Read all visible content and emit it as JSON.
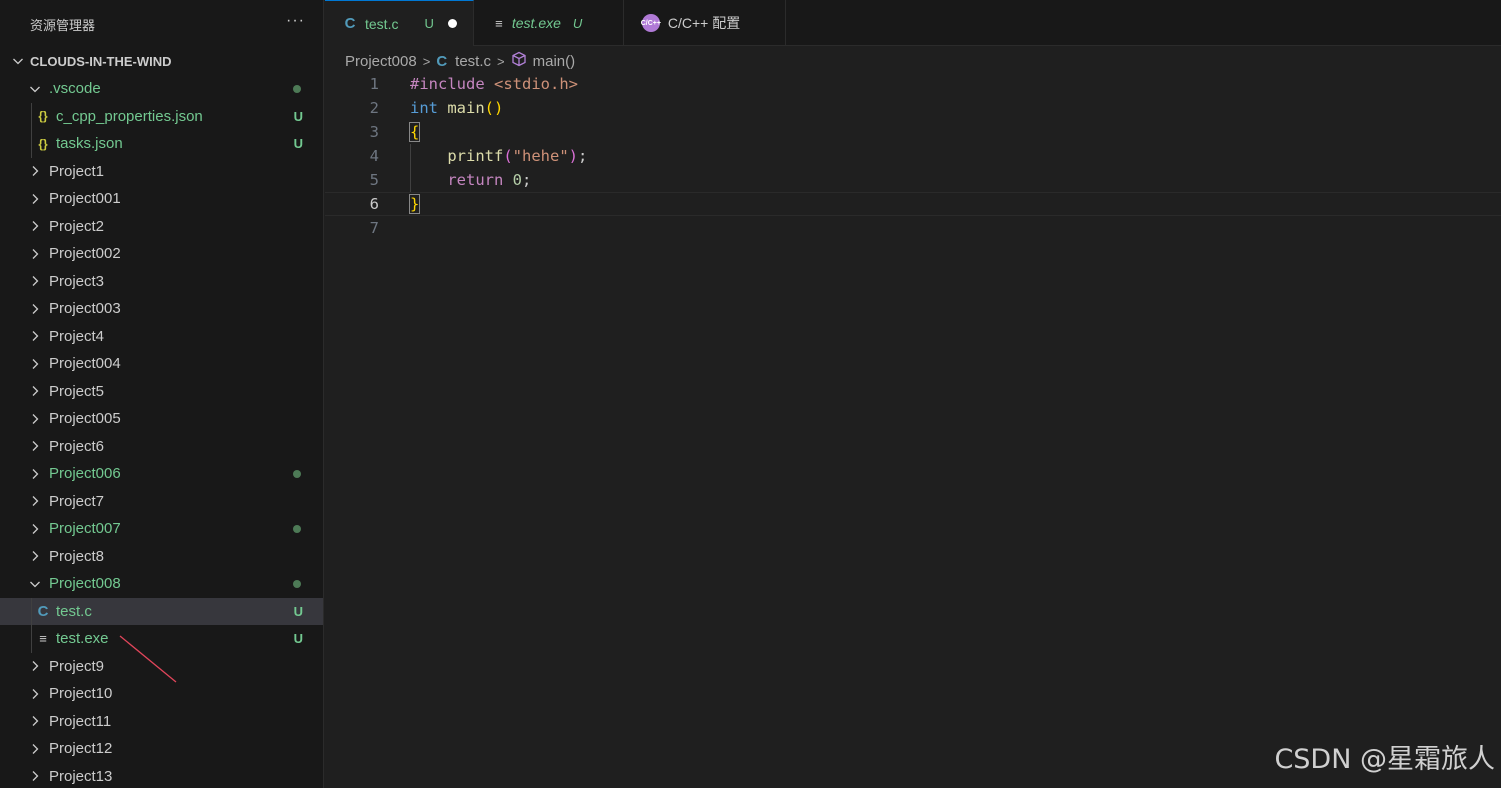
{
  "sidebar": {
    "title": "资源管理器",
    "more": "···",
    "root": "CLOUDS-IN-THE-WIND",
    "items": [
      {
        "label": ".vscode",
        "depth": 1,
        "expanded": true,
        "green": true,
        "dot": true
      },
      {
        "label": "c_cpp_properties.json",
        "depth": 2,
        "icon": "json",
        "green": true,
        "status": "U"
      },
      {
        "label": "tasks.json",
        "depth": 2,
        "icon": "json",
        "green": true,
        "status": "U"
      },
      {
        "label": "Project1",
        "depth": 1,
        "expanded": false
      },
      {
        "label": "Project001",
        "depth": 1,
        "expanded": false
      },
      {
        "label": "Project2",
        "depth": 1,
        "expanded": false
      },
      {
        "label": "Project002",
        "depth": 1,
        "expanded": false
      },
      {
        "label": "Project3",
        "depth": 1,
        "expanded": false
      },
      {
        "label": "Project003",
        "depth": 1,
        "expanded": false
      },
      {
        "label": "Project4",
        "depth": 1,
        "expanded": false
      },
      {
        "label": "Project004",
        "depth": 1,
        "expanded": false
      },
      {
        "label": "Project5",
        "depth": 1,
        "expanded": false
      },
      {
        "label": "Project005",
        "depth": 1,
        "expanded": false
      },
      {
        "label": "Project6",
        "depth": 1,
        "expanded": false
      },
      {
        "label": "Project006",
        "depth": 1,
        "expanded": false,
        "green": true,
        "dot": true
      },
      {
        "label": "Project7",
        "depth": 1,
        "expanded": false
      },
      {
        "label": "Project007",
        "depth": 1,
        "expanded": false,
        "green": true,
        "dot": true
      },
      {
        "label": "Project8",
        "depth": 1,
        "expanded": false
      },
      {
        "label": "Project008",
        "depth": 1,
        "expanded": true,
        "green": true,
        "dot": true
      },
      {
        "label": "test.c",
        "depth": 2,
        "icon": "c",
        "green": true,
        "status": "U",
        "selected": true
      },
      {
        "label": "test.exe",
        "depth": 2,
        "icon": "file",
        "green": true,
        "status": "U"
      },
      {
        "label": "Project9",
        "depth": 1,
        "expanded": false
      },
      {
        "label": "Project10",
        "depth": 1,
        "expanded": false
      },
      {
        "label": "Project11",
        "depth": 1,
        "expanded": false
      },
      {
        "label": "Project12",
        "depth": 1,
        "expanded": false
      },
      {
        "label": "Project13",
        "depth": 1,
        "expanded": false
      }
    ]
  },
  "tabs": [
    {
      "label": "test.c",
      "status": "U",
      "icon": "C",
      "active": true,
      "modified": true
    },
    {
      "label": "test.exe",
      "status": "U",
      "icon": "file",
      "italic": true
    },
    {
      "label": "C/C++ 配置",
      "icon": "cfg",
      "icon_text": "C/C++"
    }
  ],
  "breadcrumb": {
    "folder": "Project008",
    "file": "test.c",
    "file_icon": "C",
    "symbol": "main()"
  },
  "editor": {
    "current_line": 6,
    "lines": [
      {
        "n": "1",
        "text": "#include <stdio.h>"
      },
      {
        "n": "2",
        "text": "int main()"
      },
      {
        "n": "3",
        "text": "{"
      },
      {
        "n": "4",
        "text": "    printf(\"hehe\");"
      },
      {
        "n": "5",
        "text": "    return 0;"
      },
      {
        "n": "6",
        "text": "}"
      },
      {
        "n": "7",
        "text": ""
      }
    ]
  },
  "watermark": "CSDN @星霜旅人",
  "colors": {
    "git_untracked": "#73c991",
    "accent": "#0078d4",
    "sidebar_bg": "#181818",
    "editor_bg": "#1f1f1f",
    "annotation_arrow": "#e0455a"
  }
}
